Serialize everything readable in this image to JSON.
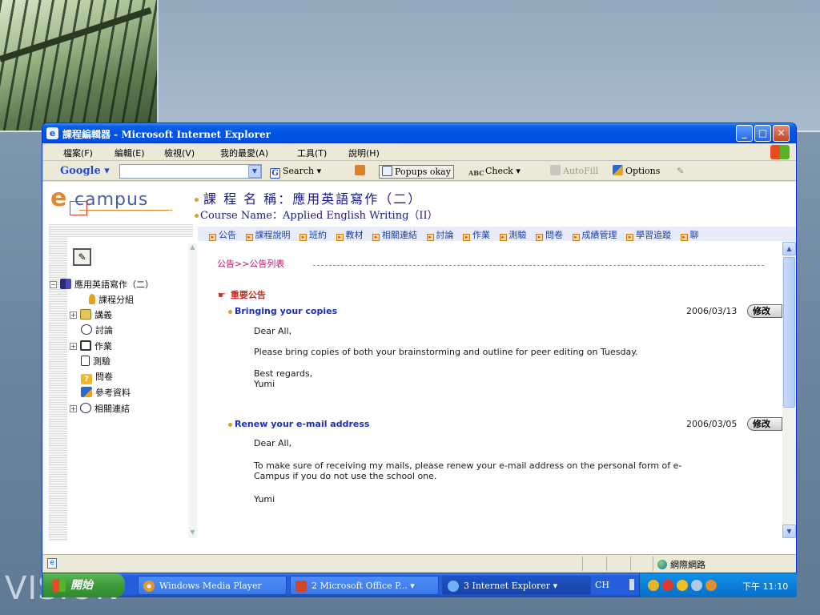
{
  "slide": {
    "watermark": "VISION"
  },
  "window": {
    "title": "課程編輯器 - Microsoft Internet Explorer",
    "controls": {
      "minimize": "_",
      "maximize": "□",
      "close": "✕"
    }
  },
  "menu": [
    "檔案(F)",
    "編輯(E)",
    "檢視(V)",
    "我的最愛(A)",
    "工具(T)",
    "說明(H)"
  ],
  "google_toolbar": {
    "logo": "Google",
    "search_label": "Search",
    "popups_label": "Popups okay",
    "check_label": "Check",
    "autofill_label": "AutoFill",
    "options_label": "Options"
  },
  "header": {
    "logo_e": "e",
    "logo_word": "campus",
    "course_title": "課 程 名 稱：應用英語寫作（二）",
    "course_name_en": "Course Name：Applied English Writing（II）"
  },
  "nav_links": [
    "公告",
    "課程說明",
    "班約",
    "教材",
    "相關連結",
    "討論",
    "作業",
    "測驗",
    "問卷",
    "成績管理",
    "學習追蹤",
    "聊"
  ],
  "tree": {
    "root": "應用英語寫作（二）",
    "items": [
      "課程分組",
      "講義",
      "討論",
      "作業",
      "測驗",
      "問卷",
      "參考資料",
      "相關連結"
    ]
  },
  "main": {
    "breadcrumb": "公告>>公告列表",
    "important_heading": "重要公告",
    "edit_label": "修改",
    "announcements": [
      {
        "title": "Bringing your copies",
        "date": "2006/03/13",
        "greeting": "Dear All,",
        "body": "Please bring copies of both your brainstorming and outline for peer editing on Tuesday.",
        "closing": "Best regards,\nYumi"
      },
      {
        "title": "Renew your e-mail address",
        "date": "2006/03/05",
        "greeting": "Dear All,",
        "body": "To make sure of receiving my mails, please renew your e-mail address on the personal form of e-\nCampus if you do not use the school one.",
        "closing": "Yumi"
      }
    ]
  },
  "statusbar": {
    "zone": "網際網路"
  },
  "taskbar": {
    "start": "開始",
    "tasks": [
      "Windows Media Player",
      "2 Microsoft Office P...",
      "3 Internet Explorer"
    ],
    "lang": "CH",
    "clock": "下午 11:10"
  }
}
